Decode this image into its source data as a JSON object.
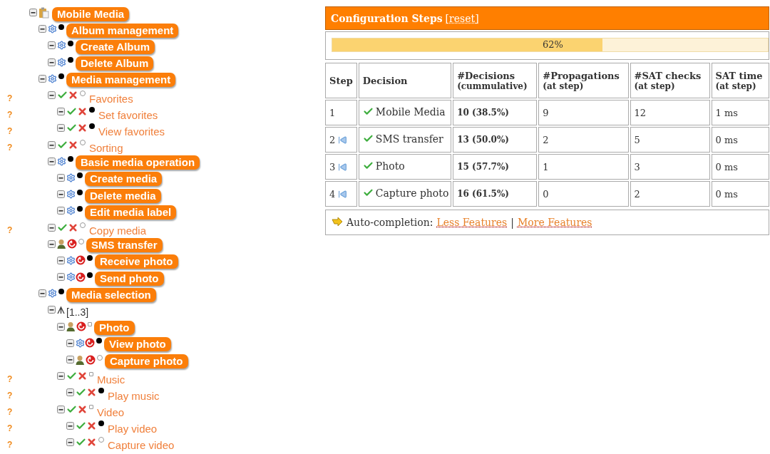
{
  "tree": [
    {
      "label": "Mobile Media",
      "kind": "root",
      "selected": true,
      "locked": false,
      "children": [
        {
          "label": "Album management",
          "kind": "gear",
          "mandatory": true,
          "selected": true,
          "locked": false,
          "children": [
            {
              "label": "Create Album",
              "kind": "gear",
              "mandatory": true,
              "selected": true,
              "locked": false
            },
            {
              "label": "Delete Album",
              "kind": "gear",
              "mandatory": true,
              "selected": true,
              "locked": false
            }
          ]
        },
        {
          "label": "Media management",
          "kind": "gear",
          "mandatory": true,
          "selected": true,
          "locked": false,
          "children": [
            {
              "label": "Favorites",
              "kind": "choice",
              "mandatory": false,
              "selected": false,
              "locked": false,
              "hint": "?",
              "children": [
                {
                  "label": "Set favorites",
                  "kind": "choice",
                  "mandatory": true,
                  "selected": false,
                  "locked": false,
                  "hint": "?"
                },
                {
                  "label": "View favorites",
                  "kind": "choice",
                  "mandatory": true,
                  "selected": false,
                  "locked": false,
                  "hint": "?"
                }
              ]
            },
            {
              "label": "Sorting",
              "kind": "choice",
              "mandatory": false,
              "selected": false,
              "locked": false,
              "hint": "?"
            },
            {
              "label": "Basic media operation",
              "kind": "gear",
              "mandatory": true,
              "selected": true,
              "locked": false,
              "children": [
                {
                  "label": "Create media",
                  "kind": "gear",
                  "mandatory": true,
                  "selected": true,
                  "locked": false
                },
                {
                  "label": "Delete media",
                  "kind": "gear",
                  "mandatory": true,
                  "selected": true,
                  "locked": false
                },
                {
                  "label": "Edit media label",
                  "kind": "gear",
                  "mandatory": true,
                  "selected": true,
                  "locked": false
                }
              ]
            },
            {
              "label": "Copy media",
              "kind": "choice",
              "mandatory": false,
              "selected": false,
              "locked": false,
              "hint": "?"
            },
            {
              "label": "SMS transfer",
              "kind": "user",
              "mandatory": false,
              "selected": true,
              "locked": true,
              "children": [
                {
                  "label": "Receive photo",
                  "kind": "gear",
                  "mandatory": true,
                  "selected": true,
                  "locked": true
                },
                {
                  "label": "Send photo",
                  "kind": "gear",
                  "mandatory": true,
                  "selected": true,
                  "locked": true
                }
              ]
            }
          ]
        },
        {
          "label": "Media selection",
          "kind": "gear",
          "mandatory": true,
          "selected": true,
          "locked": false,
          "children": [
            {
              "label": "[1..3]",
              "kind": "group",
              "children": [
                {
                  "label": "Photo",
                  "kind": "user",
                  "in_group": true,
                  "selected": true,
                  "locked": true,
                  "children": [
                    {
                      "label": "View photo",
                      "kind": "gear",
                      "mandatory": true,
                      "selected": true,
                      "locked": true
                    },
                    {
                      "label": "Capture photo",
                      "kind": "user",
                      "mandatory": false,
                      "selected": true,
                      "locked": true
                    }
                  ]
                },
                {
                  "label": "Music",
                  "kind": "choice",
                  "in_group": true,
                  "selected": false,
                  "locked": false,
                  "hint": "?",
                  "children": [
                    {
                      "label": "Play music",
                      "kind": "choice",
                      "mandatory": true,
                      "selected": false,
                      "locked": false,
                      "hint": "?"
                    }
                  ]
                },
                {
                  "label": "Video",
                  "kind": "choice",
                  "in_group": true,
                  "selected": false,
                  "locked": false,
                  "hint": "?",
                  "children": [
                    {
                      "label": "Play video",
                      "kind": "choice",
                      "mandatory": true,
                      "selected": false,
                      "locked": false,
                      "hint": "?"
                    },
                    {
                      "label": "Capture video",
                      "kind": "choice",
                      "mandatory": false,
                      "selected": false,
                      "locked": false,
                      "hint": "?"
                    }
                  ]
                }
              ]
            }
          ]
        }
      ]
    }
  ],
  "panel": {
    "title": "Configuration Steps",
    "reset": "[reset]",
    "progress": {
      "level": 0.62,
      "text": "62%"
    },
    "columns": [
      {
        "title": "Step"
      },
      {
        "title": "Decision"
      },
      {
        "title": "#Decisions",
        "sub": "(cummulative)"
      },
      {
        "title": "#Propagations",
        "sub": "(at step)"
      },
      {
        "title": "#SAT checks",
        "sub": "(at step)"
      },
      {
        "title": "SAT time",
        "sub": "(at step)"
      }
    ],
    "rows": [
      {
        "step": "1",
        "undo": false,
        "decision": "Mobile Media",
        "decisions": "10 (38.5%)",
        "propagations": "9",
        "sat_checks": "12",
        "sat_time": "1 ms"
      },
      {
        "step": "2",
        "undo": true,
        "decision": "SMS transfer",
        "decisions": "13 (50.0%)",
        "propagations": "2",
        "sat_checks": "5",
        "sat_time": "0 ms"
      },
      {
        "step": "3",
        "undo": true,
        "decision": "Photo",
        "decisions": "15 (57.7%)",
        "propagations": "1",
        "sat_checks": "3",
        "sat_time": "0 ms"
      },
      {
        "step": "4",
        "undo": true,
        "decision": "Capture photo",
        "decisions": "16 (61.5%)",
        "propagations": "0",
        "sat_checks": "2",
        "sat_time": "0 ms"
      }
    ],
    "autocompletion": {
      "label": "Auto-completion:",
      "links": [
        "Less Features",
        "More Features"
      ],
      "separator": "|"
    }
  }
}
